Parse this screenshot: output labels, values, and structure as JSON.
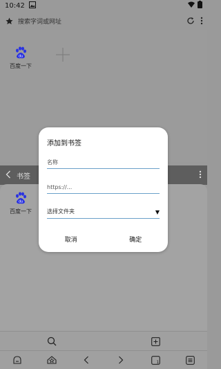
{
  "status_bar": {
    "time": "10:42"
  },
  "address_bar": {
    "placeholder": "搜索字词或网址"
  },
  "home": {
    "shortcut_label": "百度一下"
  },
  "bookmarks_panel": {
    "title": "书签",
    "item_label": "百度一下"
  },
  "dialog": {
    "title": "添加到书签",
    "name_placeholder": "名称",
    "url_placeholder": "https://...",
    "folder_label": "选择文件夹",
    "cancel_label": "取消",
    "confirm_label": "确定"
  },
  "colors": {
    "overlay_bg": "#9a9a9a",
    "header_dark": "#5e5e5e",
    "baidu_blue": "#2932e1",
    "field_line": "#6aa0c9"
  },
  "icons": [
    "image-icon",
    "wifi-icon",
    "battery-icon",
    "star-icon",
    "refresh-icon",
    "more-vertical-icon",
    "plus-icon",
    "back-chevron-icon",
    "search-icon",
    "add-square-icon",
    "home-icon",
    "bookmark-home-icon",
    "back-icon",
    "forward-icon",
    "tabs-icon",
    "menu-icon",
    "baidu-paw-icon"
  ]
}
